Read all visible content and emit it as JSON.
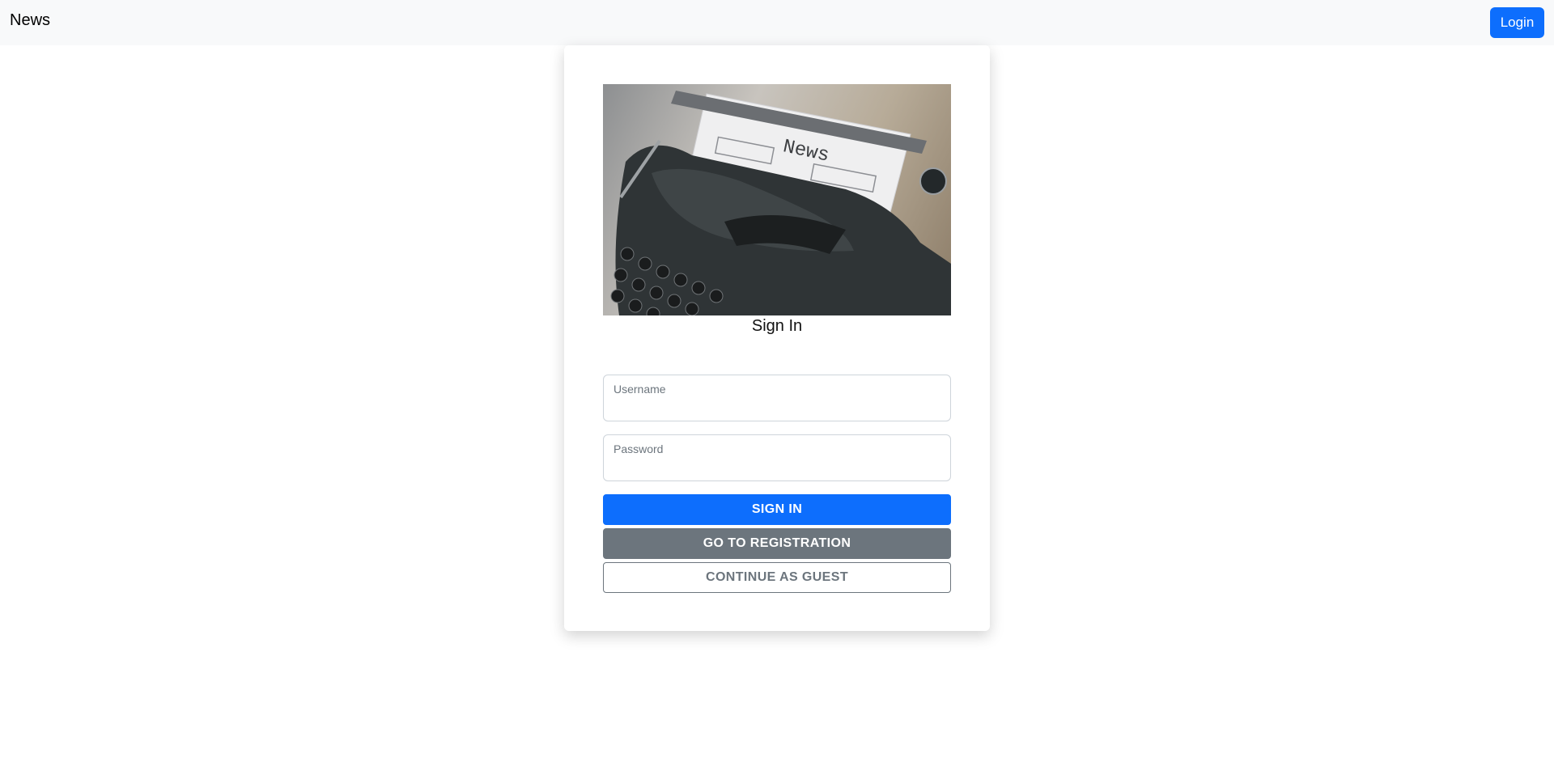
{
  "navbar": {
    "brand": "News",
    "login_label": "Login"
  },
  "card": {
    "image_icon": "typewriter-news-photo",
    "image_text": "News",
    "title": "Sign In",
    "username": {
      "label": "Username",
      "value": ""
    },
    "password": {
      "label": "Password",
      "value": ""
    },
    "sign_in_label": "SIGN IN",
    "registration_label": "GO TO REGISTRATION",
    "guest_label": "CONTINUE AS GUEST"
  },
  "colors": {
    "primary": "#0d6efd",
    "secondary": "#6c757d",
    "navbar_bg": "#f8f9fa"
  }
}
